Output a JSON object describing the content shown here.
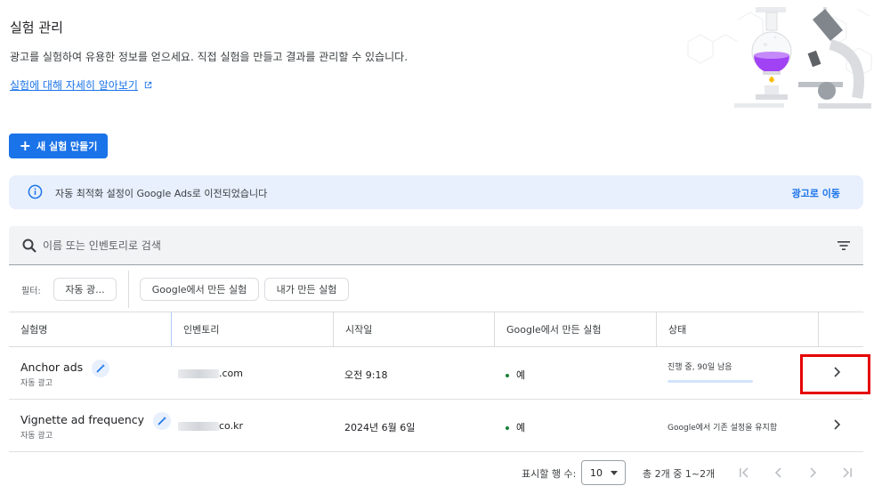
{
  "header": {
    "title": "실험 관리",
    "description": "광고를 실험하여 유용한 정보를 얻으세요. 직접 실험을 만들고 결과를 관리할 수 있습니다.",
    "learn_more": "실험에 대해 자세히 알아보기"
  },
  "toolbar": {
    "create_label": "새 실험 만들기"
  },
  "notice": {
    "text": "자동 최적화 설정이 Google Ads로 이전되었습니다",
    "link": "광고로 이동"
  },
  "search": {
    "placeholder": "이름 또는 인벤토리로 검색"
  },
  "filters": {
    "label": "필터:",
    "chips": [
      "자동 광...",
      "Google에서 만든 실험",
      "내가 만든 실험"
    ]
  },
  "table": {
    "columns": [
      "실험명",
      "인벤토리",
      "시작일",
      "Google에서 만든 실험",
      "상태"
    ],
    "rows": [
      {
        "name": "Anchor ads",
        "type": "자동 광고",
        "inventory_suffix": ".com",
        "start": "오전 9:18",
        "by_google": "예",
        "status": "진행 중, 90일 남음",
        "progress": 0.0
      },
      {
        "name": "Vignette ad frequency",
        "type": "자동 광고",
        "inventory_suffix": "co.kr",
        "start": "2024년 6월 6일",
        "by_google": "예",
        "status": "Google에서 기존 설정을 유지함"
      }
    ]
  },
  "pagination": {
    "rows_label": "표시할 행 수:",
    "rows_value": "10",
    "range": "총 2개 중 1~2개"
  },
  "colors": {
    "primary": "#1a73e8",
    "notice_bg": "#e8f0fe",
    "status_green": "#188038",
    "highlight": "#e50000"
  }
}
